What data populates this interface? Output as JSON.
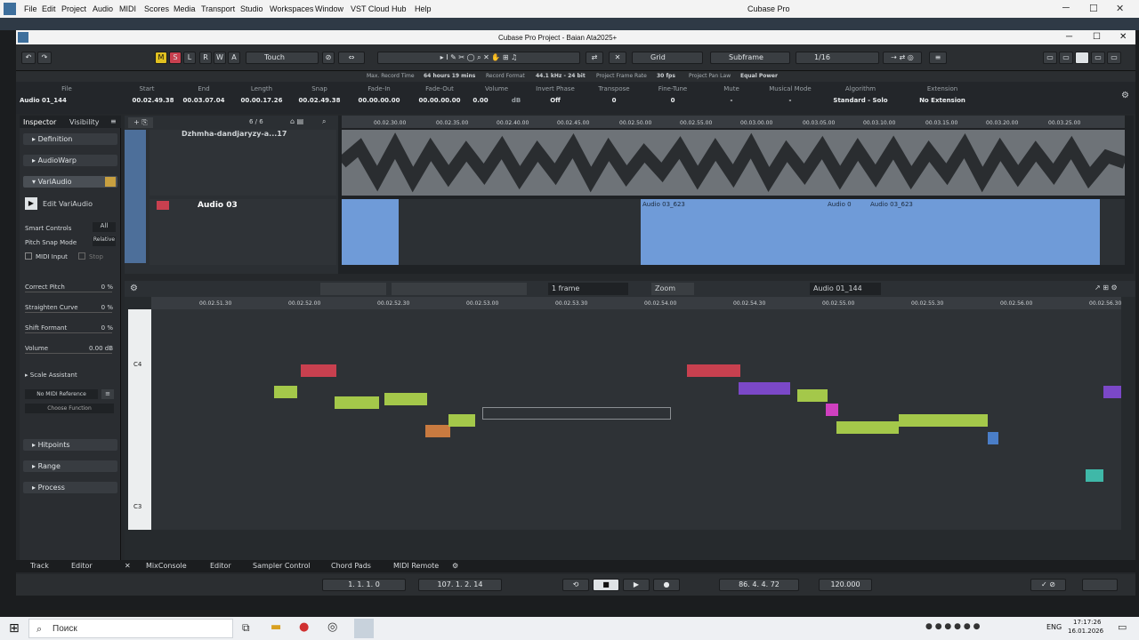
{
  "menubar": {
    "items": [
      "File",
      "Edit",
      "Project",
      "Audio",
      "MIDI",
      "Scores",
      "Media",
      "Transport",
      "Studio",
      "Workspaces",
      "Window",
      "VST Cloud",
      "Hub",
      "Help"
    ],
    "app_title": "Cubase Pro"
  },
  "project_window": {
    "title": "Cubase Pro Project - Baian Ata2025+"
  },
  "toolbar": {
    "buttons": [
      "M",
      "S",
      "L",
      "R",
      "W",
      "A"
    ],
    "automation_mode": "Touch",
    "snap_type": "Grid",
    "snap_quantize": "Subframe",
    "quantize_value": "1/16",
    "rec_time_label": "Max. Record Time",
    "rec_time_value": "64 hours 19 mins",
    "rec_format_label": "Record Format",
    "rec_format_value": "44.1 kHz - 24 bit",
    "frame_rate_label": "Project Frame Rate",
    "frame_rate_value": "30 fps",
    "pan_law_label": "Project Pan Law",
    "pan_law_value": "Equal Power"
  },
  "infobar": {
    "fields": [
      {
        "label": "File",
        "value": "Audio 01_144"
      },
      {
        "label": "Start",
        "value": "00.02.49.38"
      },
      {
        "label": "End",
        "value": "00.03.07.04"
      },
      {
        "label": "Length",
        "value": "00.00.17.26"
      },
      {
        "label": "Snap",
        "value": "00.02.49.38"
      },
      {
        "label": "Fade-In",
        "value": "00.00.00.00"
      },
      {
        "label": "Fade-Out",
        "value": "00.00.00.00"
      },
      {
        "label": "Volume",
        "value": "0.00"
      },
      {
        "label": "Invert Phase",
        "value": "Off"
      },
      {
        "label": "Transpose",
        "value": "0"
      },
      {
        "label": "Fine-Tune",
        "value": "0"
      },
      {
        "label": "Mute",
        "value": "-"
      },
      {
        "label": "Musical Mode",
        "value": "-"
      },
      {
        "label": "Algorithm",
        "value": "Standard - Solo"
      },
      {
        "label": "Extension",
        "value": "No Extension"
      }
    ],
    "volume_unit": "dB"
  },
  "inspector": {
    "tabs": [
      "Inspector",
      "Visibility"
    ],
    "sections": [
      "Definition",
      "AudioWarp",
      "VariAudio"
    ],
    "edit_variaudio": "Edit VariAudio",
    "smart_controls_label": "Smart Controls",
    "smart_controls_value": "All",
    "pitch_snap_label": "Pitch Snap Mode",
    "pitch_snap_value": "Relative",
    "midi_input": "MIDI Input",
    "stop": "Stop",
    "sliders": [
      {
        "label": "Correct Pitch",
        "value": "0 %"
      },
      {
        "label": "Straighten Curve",
        "value": "0 %"
      },
      {
        "label": "Shift Formant",
        "value": "0 %"
      },
      {
        "label": "Volume",
        "value": "0.00 dB"
      }
    ],
    "scale_assistant": "Scale Assistant",
    "midi_reference": "No MIDI Reference",
    "choose_function": "Choose Function",
    "lower_sections": [
      "Hitpoints",
      "Range",
      "Process"
    ]
  },
  "tracks": {
    "counter": "6 / 6",
    "track1_name": "Dzhmha-dandjaryzy-a...17",
    "track2_name": "Audio 03",
    "ruler": [
      "00.02.30.00",
      "00.02.35.00",
      "00.02.40.00",
      "00.02.45.00",
      "00.02.50.00",
      "00.02.55.00",
      "00.03.00.00",
      "00.03.05.00",
      "00.03.10.00",
      "00.03.15.00",
      "00.03.20.00",
      "00.03.25.00"
    ],
    "clips": [
      "Audio 03_623",
      "Audio 0",
      "Audio 03_623"
    ]
  },
  "editor": {
    "quantize": "1 frame",
    "zoom": "Zoom",
    "event": "Audio 01_144",
    "ruler": [
      "00.02.51.30",
      "00.02.52.00",
      "00.02.52.30",
      "00.02.53.00",
      "00.02.53.30",
      "00.02.54.00",
      "00.02.54.30",
      "00.02.55.00",
      "00.02.55.30",
      "00.02.56.00",
      "00.02.56.30"
    ],
    "key_labels": [
      "C4",
      "C3"
    ],
    "colors": {
      "red": "#c8404f",
      "green": "#a4c84a",
      "purple": "#7b48c8",
      "orange": "#c87a40",
      "blue": "#4a7ec8",
      "teal": "#3fb8a8",
      "pink": "#d040c0"
    }
  },
  "bottom_tabs": {
    "left": [
      "Track",
      "Editor"
    ],
    "right": [
      "MixConsole",
      "Editor",
      "Sampler Control",
      "Chord Pads",
      "MIDI Remote"
    ]
  },
  "transport": {
    "left_locator": "1. 1. 1. 0",
    "right_locator": "107. 1. 2. 14",
    "position": "86. 4. 4. 72",
    "tempo": "120.000"
  },
  "taskbar": {
    "search_placeholder": "Поиск",
    "language": "ENG",
    "time": "17:17:26",
    "date": "16.01.2026"
  }
}
